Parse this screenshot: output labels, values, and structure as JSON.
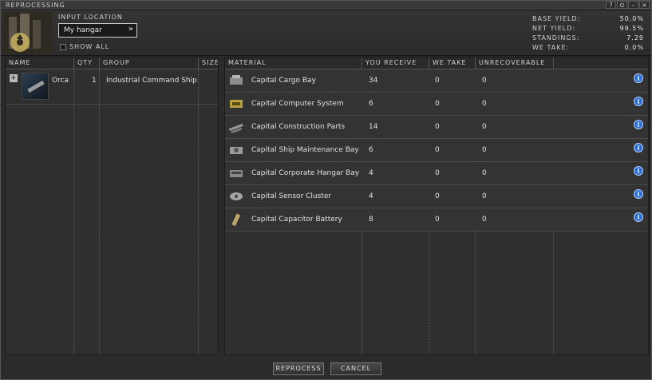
{
  "window": {
    "title": "REPROCESSING"
  },
  "window_buttons": [
    "?",
    "⊙",
    "–",
    "×"
  ],
  "header": {
    "input_location_label": "INPUT LOCATION",
    "input_location_value": "My hangar",
    "show_all_label": "SHOW ALL",
    "stats": [
      {
        "label": "BASE YIELD:",
        "value": "50.0%"
      },
      {
        "label": "NET YIELD:",
        "value": "99.5%"
      },
      {
        "label": "STANDINGS:",
        "value": "7.29"
      },
      {
        "label": "WE TAKE:",
        "value": "0.0%"
      }
    ]
  },
  "left_table": {
    "columns": [
      "NAME",
      "QTY",
      "GROUP",
      "SIZE"
    ],
    "rows": [
      {
        "name": "Orca",
        "qty": "1",
        "group": "Industrial Command Ship",
        "size": ""
      }
    ]
  },
  "right_table": {
    "columns": [
      "MATERIAL",
      "YOU RECEIVE",
      "WE TAKE",
      "UNRECOVERABLE"
    ],
    "rows": [
      {
        "material": "Capital Cargo Bay",
        "receive": "34",
        "take": "0",
        "unrecoverable": "0",
        "icon": "cargo-bay-icon"
      },
      {
        "material": "Capital Computer System",
        "receive": "6",
        "take": "0",
        "unrecoverable": "0",
        "icon": "computer-system-icon"
      },
      {
        "material": "Capital Construction Parts",
        "receive": "14",
        "take": "0",
        "unrecoverable": "0",
        "icon": "construction-parts-icon"
      },
      {
        "material": "Capital Ship Maintenance Bay",
        "receive": "6",
        "take": "0",
        "unrecoverable": "0",
        "icon": "maintenance-bay-icon"
      },
      {
        "material": "Capital Corporate Hangar Bay",
        "receive": "4",
        "take": "0",
        "unrecoverable": "0",
        "icon": "hangar-bay-icon"
      },
      {
        "material": "Capital Sensor Cluster",
        "receive": "4",
        "take": "0",
        "unrecoverable": "0",
        "icon": "sensor-cluster-icon"
      },
      {
        "material": "Capital Capacitor Battery",
        "receive": "8",
        "take": "0",
        "unrecoverable": "0",
        "icon": "capacitor-battery-icon"
      }
    ]
  },
  "buttons": {
    "reprocess": "REPROCESS",
    "cancel": "CANCEL"
  }
}
